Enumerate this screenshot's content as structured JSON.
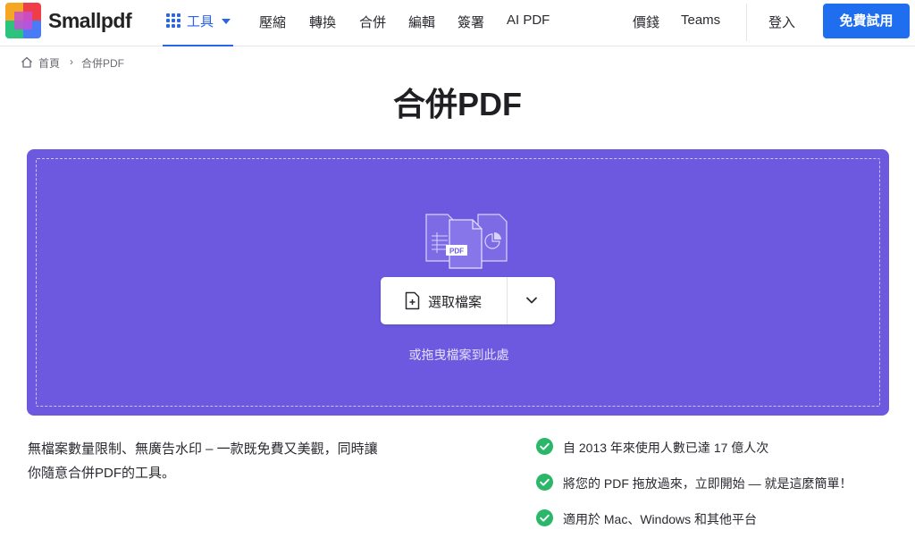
{
  "brand": {
    "name": "Smallpdf",
    "logo_colors": [
      "#f5a623",
      "#ef3e4a",
      "#2bc37e",
      "#4a7bf7"
    ]
  },
  "nav": {
    "tools_label": "工具",
    "items": [
      "壓縮",
      "轉換",
      "合併",
      "編輯",
      "簽署",
      "AI PDF"
    ],
    "pricing": "價錢",
    "teams": "Teams",
    "login": "登入",
    "cta": "免費試用"
  },
  "breadcrumb": {
    "home": "首頁",
    "separator": "›",
    "current": "合併PDF"
  },
  "page_title": "合併PDF",
  "dropzone": {
    "color": "#6c59e0",
    "choose_file": "選取檔案",
    "drop_hint": "或拖曳檔案到此處",
    "art_label": "PDF"
  },
  "description": {
    "line1": "無檔案數量限制、無廣告水印 – 一款既免費又美觀，同時讓",
    "line2": "你隨意合併PDF的工具。"
  },
  "features": [
    "自 2013 年來使用人數已達 17 億人次",
    "將您的 PDF 拖放過來，立即開始 — 就是這麼簡單！",
    "適用於 Mac、Windows 和其他平台"
  ],
  "colors": {
    "accent": "#1f6ef0",
    "check": "#2bb769"
  }
}
